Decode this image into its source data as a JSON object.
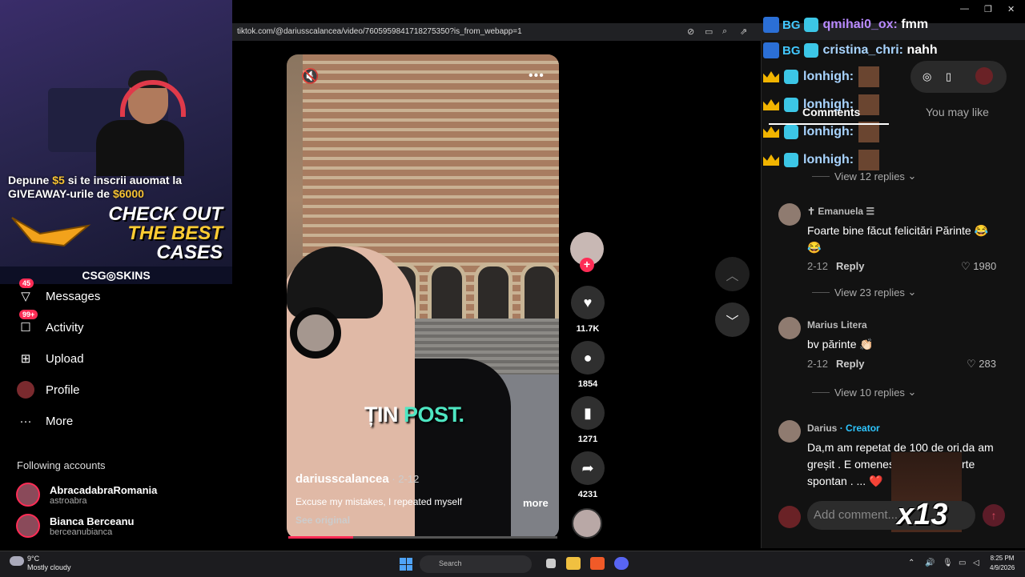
{
  "browser": {
    "url": "tiktok.com/@dariusscalancea/video/7605959841718275350?is_from_webapp=1"
  },
  "stream_overlay": {
    "promo_line1_a": "Depune ",
    "promo_amount1": "$5",
    "promo_line1_b": " si te inscrii auomat la",
    "promo_line2_a": "GIVEAWAY-urile de ",
    "promo_amount2": "$6000",
    "check_out_1": "CHECK OUT",
    "check_out_2": "THE BEST",
    "check_out_3": "CASES",
    "brand": "CSG◎SKINS"
  },
  "sidebar": {
    "messages": {
      "label": "Messages",
      "badge": "45"
    },
    "activity": {
      "label": "Activity",
      "badge": "99+"
    },
    "upload": {
      "label": "Upload"
    },
    "profile": {
      "label": "Profile"
    },
    "more": {
      "label": "More"
    },
    "following_title": "Following accounts",
    "following": [
      {
        "name": "AbracadabraRomania",
        "handle": "astroabra"
      },
      {
        "name": "Bianca Berceanu",
        "handle": "berceanubianca"
      }
    ]
  },
  "video": {
    "caption_white": "ȚIN ",
    "caption_green": "POST.",
    "author": "dariusscalancea",
    "date": " · 2-12",
    "description": "Excuse my mistakes, I repeated myself",
    "more": "more",
    "see_original": "See original",
    "progress_fraction": 0.24
  },
  "actions": {
    "likes": "11.7K",
    "comments": "1854",
    "saves": "1271",
    "shares": "4231"
  },
  "chat": [
    {
      "user": "qmihai0_ox:",
      "msg": "fmm"
    },
    {
      "user": "cristina_chri:",
      "msg": "nahh"
    },
    {
      "user": "lonhigh:"
    },
    {
      "user": "lonhigh:"
    },
    {
      "user": "lonhigh:"
    },
    {
      "user": "lonhigh:"
    }
  ],
  "panel": {
    "tab_comments": "Comments",
    "tab_may_like": "You may like",
    "view_replies_1": "View 12 replies",
    "comments": [
      {
        "name": "✝ Emanuela ☰",
        "text": "Foarte bine făcut felicitări Părinte 😂😂",
        "date": "2-12",
        "reply": "Reply",
        "likes": "1980",
        "view_replies": "View 23 replies"
      },
      {
        "name": "Marius Litera",
        "text": "bv părinte 👏🏻",
        "date": "2-12",
        "reply": "Reply",
        "likes": "283",
        "view_replies": "View 10 replies"
      },
      {
        "name": "Darius",
        "creator": " · Creator",
        "text": "Da,m am repetat de 100 de ori,da am greșit . E omenesc , ... totul foarte spontan . ... ❤️"
      }
    ],
    "add_comment_placeholder": "Add comment...",
    "overlay_counter": "x13"
  },
  "taskbar": {
    "temp": "9°C",
    "weather": "Mostly cloudy",
    "search": "Search",
    "time": "8:25 PM",
    "date": "4/9/2026"
  }
}
